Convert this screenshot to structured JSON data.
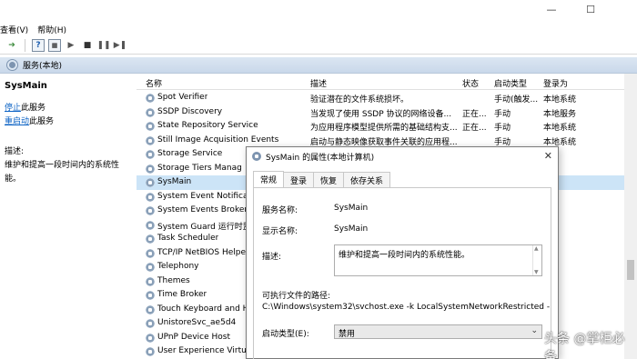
{
  "window": {
    "minimize": "—",
    "maximize": "☐"
  },
  "menu": [
    "查看(V)",
    "帮助(H)"
  ],
  "band": {
    "title": "服务(本地)"
  },
  "left": {
    "service_name": "SysMain",
    "stop_link": "停止",
    "stop_suffix": "此服务",
    "restart_link": "重启动",
    "restart_suffix": "此服务",
    "desc_label": "描述:",
    "desc_text": "维护和提高一段时间内的系统性能。"
  },
  "columns": {
    "name": "名称",
    "desc": "描述",
    "status": "状态",
    "startup": "启动类型",
    "logon": "登录为"
  },
  "rows": [
    {
      "name": "Spot Verifier",
      "desc": "验证潜在的文件系统损坏。",
      "status": "",
      "startup": "手动(触发...",
      "logon": "本地系统"
    },
    {
      "name": "SSDP Discovery",
      "desc": "当发现了使用 SSDP 协议的网络设备...",
      "status": "正在...",
      "startup": "手动",
      "logon": "本地服务"
    },
    {
      "name": "State Repository Service",
      "desc": "为应用程序模型提供所需的基础结构支...",
      "status": "正在...",
      "startup": "手动",
      "logon": "本地系统"
    },
    {
      "name": "Still Image Acquisition Events",
      "desc": "启动与静态映像获取事件关联的应用程...",
      "status": "",
      "startup": "手动",
      "logon": "本地系统"
    },
    {
      "name": "Storage Service",
      "desc": "",
      "status": "",
      "startup": "",
      "logon": ""
    },
    {
      "name": "Storage Tiers Manag",
      "desc": "",
      "status": "",
      "startup": "",
      "logon": ""
    },
    {
      "name": "SysMain",
      "desc": "",
      "status": "",
      "startup": "",
      "logon": ""
    },
    {
      "name": "System Event Notifica",
      "desc": "",
      "status": "",
      "startup": "",
      "logon": ""
    },
    {
      "name": "System Events Broker",
      "desc": "",
      "status": "",
      "startup": "",
      "logon": ""
    },
    {
      "name": "System Guard 运行时监",
      "desc": "",
      "status": "",
      "startup": "",
      "logon": ""
    },
    {
      "name": "Task Scheduler",
      "desc": "",
      "status": "",
      "startup": "",
      "logon": ""
    },
    {
      "name": "TCP/IP NetBIOS Helpe",
      "desc": "",
      "status": "",
      "startup": "",
      "logon": ""
    },
    {
      "name": "Telephony",
      "desc": "",
      "status": "",
      "startup": "",
      "logon": ""
    },
    {
      "name": "Themes",
      "desc": "",
      "status": "",
      "startup": "",
      "logon": ""
    },
    {
      "name": "Time Broker",
      "desc": "",
      "status": "",
      "startup": "",
      "logon": ""
    },
    {
      "name": "Touch Keyboard and H",
      "desc": "",
      "status": "",
      "startup": "",
      "logon": ""
    },
    {
      "name": "UnistoreSvc_ae5d4",
      "desc": "",
      "status": "",
      "startup": "",
      "logon": ""
    },
    {
      "name": "UPnP Device Host",
      "desc": "",
      "status": "",
      "startup": "",
      "logon": ""
    },
    {
      "name": "User Experience Virtua",
      "desc": "",
      "status": "",
      "startup": "",
      "logon": ""
    }
  ],
  "dialog": {
    "title": "SysMain 的属性(本地计算机)",
    "close": "✕",
    "tabs": [
      "常规",
      "登录",
      "恢复",
      "依存关系"
    ],
    "service_name_label": "服务名称:",
    "service_name_value": "SysMain",
    "display_name_label": "显示名称:",
    "display_name_value": "SysMain",
    "desc_label": "描述:",
    "desc_value": "维护和提高一段时间内的系统性能。",
    "path_label": "可执行文件的路径:",
    "path_value": "C:\\Windows\\system32\\svchost.exe -k LocalSystemNetworkRestricted -p",
    "startup_label": "启动类型(E):",
    "startup_value": "禁用"
  },
  "watermark": "头条 @掌柜必备"
}
